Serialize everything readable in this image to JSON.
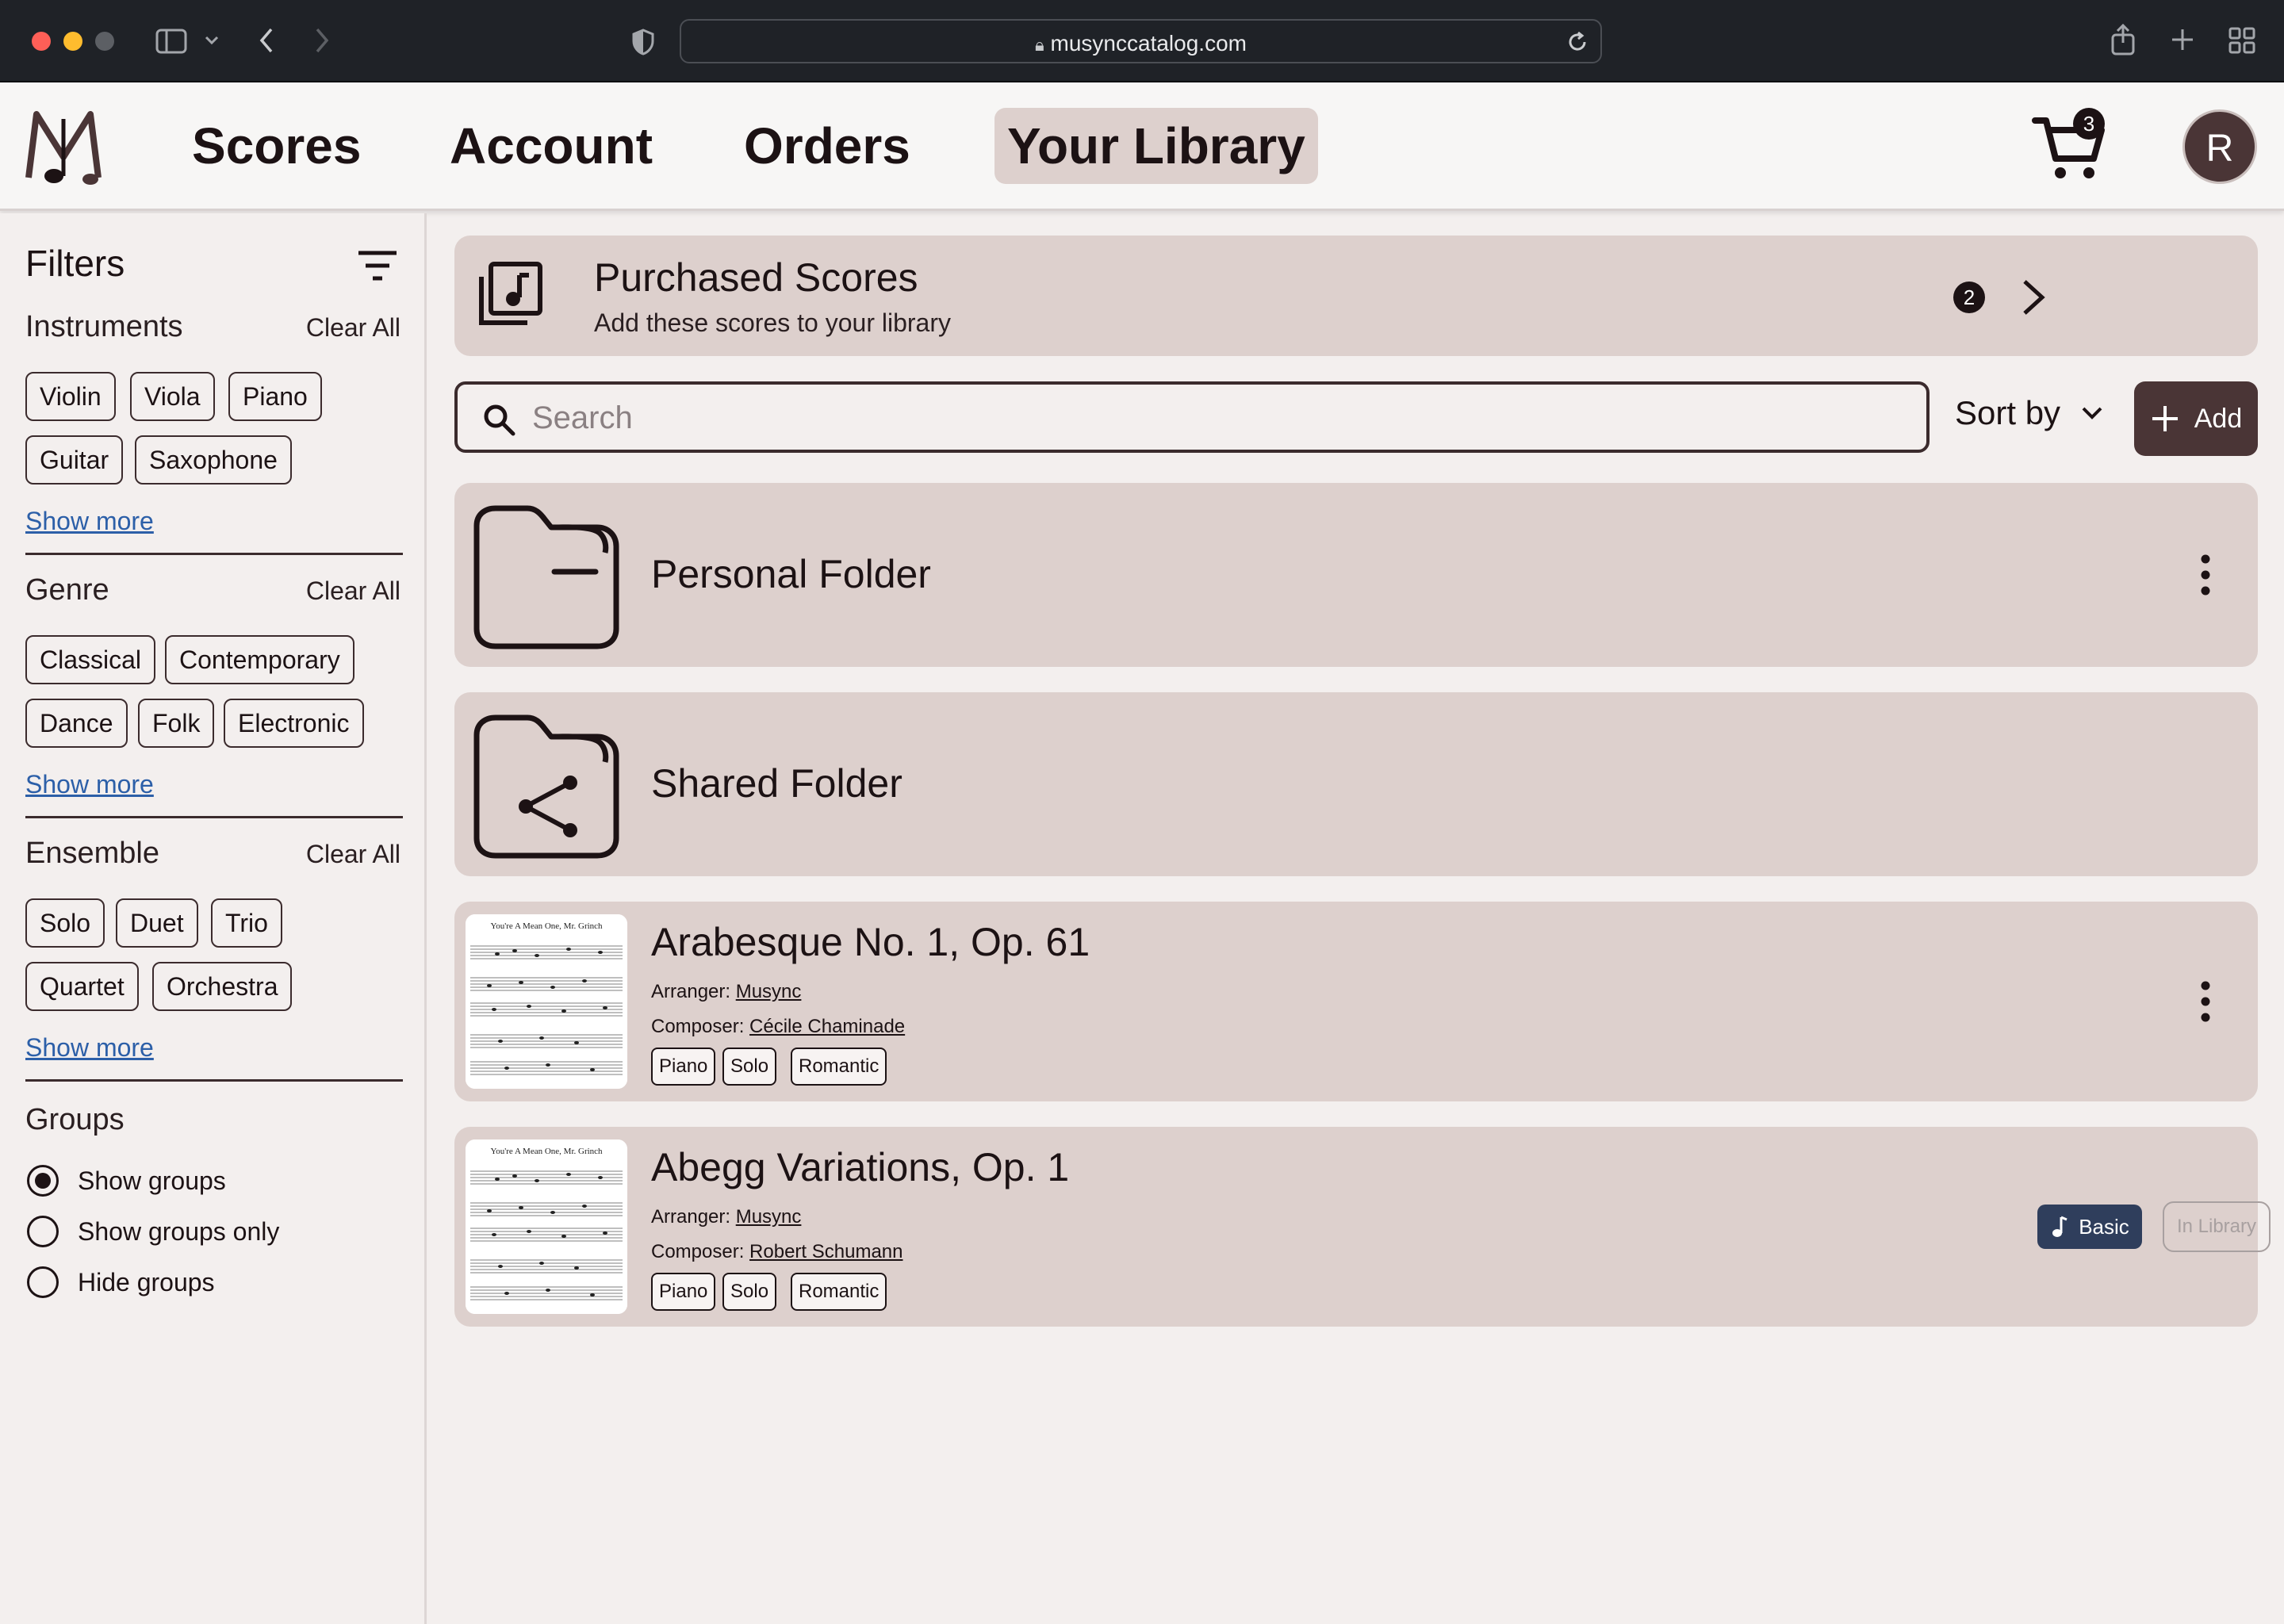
{
  "browser": {
    "url": "musynccatalog.com"
  },
  "header": {
    "nav": {
      "scores": "Scores",
      "account": "Account",
      "orders": "Orders",
      "library": "Your Library"
    },
    "cart_count": "3",
    "avatar_initial": "R"
  },
  "sidebar": {
    "title": "Filters",
    "clear_all": "Clear All",
    "show_more": "Show more",
    "instruments": {
      "title": "Instruments",
      "chips": [
        "Violin",
        "Viola",
        "Piano",
        "Guitar",
        "Saxophone"
      ]
    },
    "genre": {
      "title": "Genre",
      "chips": [
        "Classical",
        "Contemporary",
        "Dance",
        "Folk",
        "Electronic"
      ]
    },
    "ensemble": {
      "title": "Ensemble",
      "chips": [
        "Solo",
        "Duet",
        "Trio",
        "Quartet",
        "Orchestra"
      ]
    },
    "groups": {
      "title": "Groups",
      "options": [
        "Show groups",
        "Show groups only",
        "Hide groups"
      ],
      "selected": "Show groups"
    }
  },
  "purchased": {
    "title": "Purchased Scores",
    "subtitle": "Add these scores to your library",
    "count": "2"
  },
  "toolbar": {
    "search_placeholder": "Search",
    "sort_label": "Sort by",
    "add_label": "Add"
  },
  "folders": [
    {
      "name": "Personal Folder",
      "icon": "folder-icon"
    },
    {
      "name": "Shared Folder",
      "icon": "shared-folder-icon"
    }
  ],
  "scores": [
    {
      "title": "Arabesque No. 1, Op. 61",
      "arranger_label": "Arranger:",
      "arranger": "Musync",
      "composer_label": "Composer:",
      "composer": "Cécile Chaminade",
      "tags": [
        "Piano",
        "Solo",
        "Romantic"
      ],
      "thumb_title": "You're A Mean One, Mr. Grinch"
    },
    {
      "title": "Abegg Variations, Op. 1",
      "arranger_label": "Arranger:",
      "arranger": "Musync",
      "composer_label": "Composer:",
      "composer": "Robert Schumann",
      "tags": [
        "Piano",
        "Solo",
        "Romantic"
      ],
      "thumb_title": "You're A Mean One, Mr. Grinch",
      "tier": "Basic",
      "status": "In Library"
    }
  ],
  "colors": {
    "accent": "#4a3536",
    "card": "#ddd0cd",
    "background": "#f3efee",
    "basic_badge": "#2f3e5c"
  }
}
